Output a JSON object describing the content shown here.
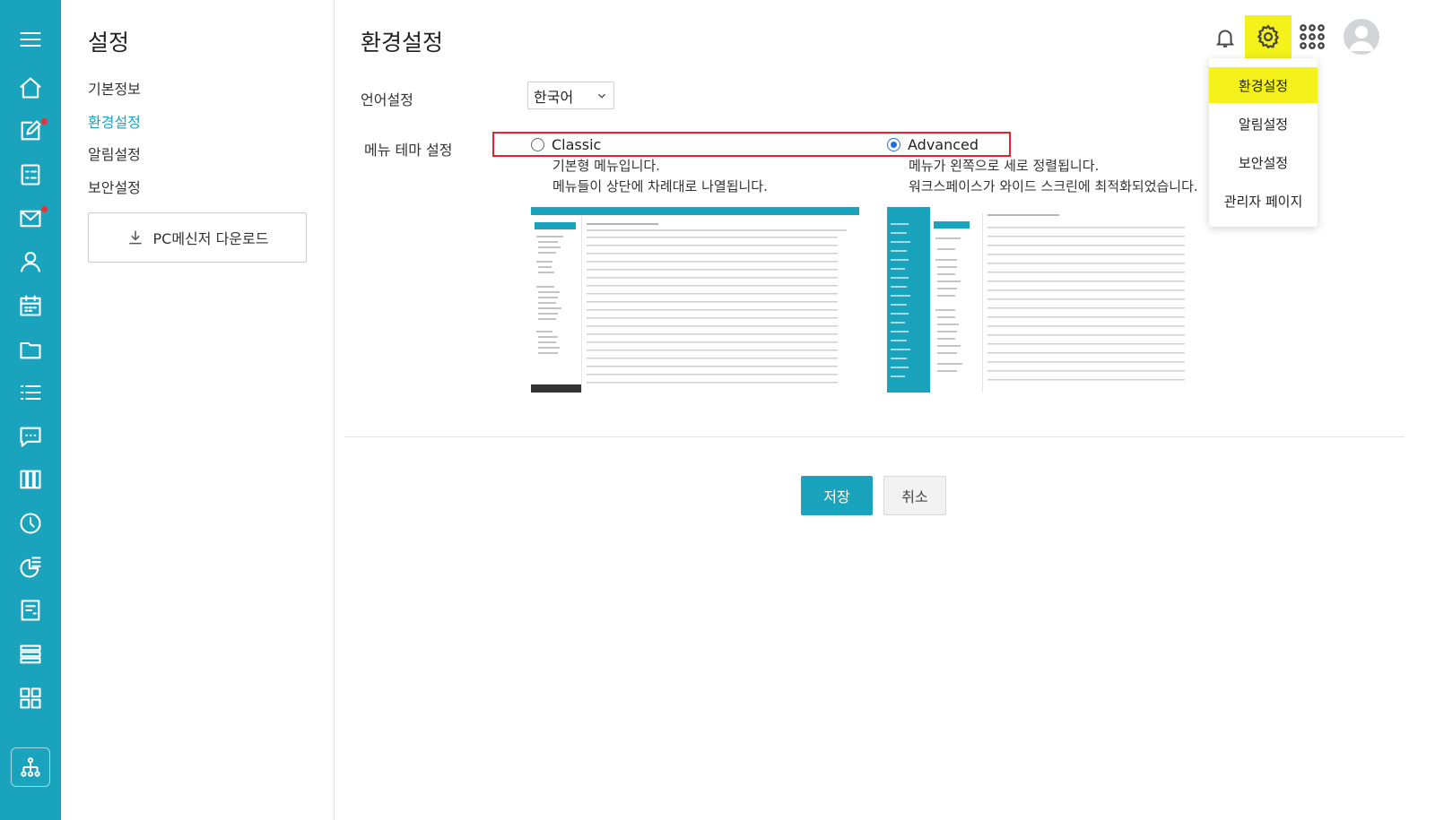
{
  "sidebar": {
    "title": "설정",
    "items": [
      {
        "label": "기본정보",
        "active": false
      },
      {
        "label": "환경설정",
        "active": true
      },
      {
        "label": "알림설정",
        "active": false
      },
      {
        "label": "보안설정",
        "active": false
      }
    ],
    "download_label": "PC메신저 다운로드"
  },
  "rail": {
    "icons": [
      "menu-icon",
      "home-icon",
      "edit-icon",
      "checklist-icon",
      "mail-icon",
      "user-icon",
      "calendar-icon",
      "folder-icon",
      "list-icon",
      "chat-icon",
      "board-icon",
      "clock-icon",
      "report-icon",
      "note-icon",
      "stack-icon",
      "grid-icon"
    ],
    "badges": [
      "edit-icon",
      "mail-icon"
    ]
  },
  "main": {
    "title": "환경설정",
    "language_label": "언어설정",
    "language_value": "한국어",
    "theme_label": "메뉴 테마 설정",
    "themes": [
      {
        "name": "Classic",
        "selected": false,
        "desc1": "기본형 메뉴입니다.",
        "desc2": "메뉴들이 상단에 차례대로 나열됩니다."
      },
      {
        "name": "Advanced",
        "selected": true,
        "desc1": "메뉴가 왼쪽으로 세로 정렬됩니다.",
        "desc2": "워크스페이스가 와이드 스크린에 최적화되었습니다."
      }
    ],
    "save_label": "저장",
    "cancel_label": "취소"
  },
  "header": {
    "icons": [
      "bell-icon",
      "gear-icon",
      "apps-icon",
      "avatar"
    ]
  },
  "settings_menu": {
    "items": [
      {
        "label": "환경설정",
        "highlighted": true
      },
      {
        "label": "알림설정",
        "highlighted": false
      },
      {
        "label": "보안설정",
        "highlighted": false
      },
      {
        "label": "관리자 페이지",
        "highlighted": false
      }
    ]
  },
  "colors": {
    "brand": "#1aa3bd",
    "highlight": "#f4f21a",
    "focus_box": "#e0252b",
    "radio_selected": "#1f6fe0"
  }
}
